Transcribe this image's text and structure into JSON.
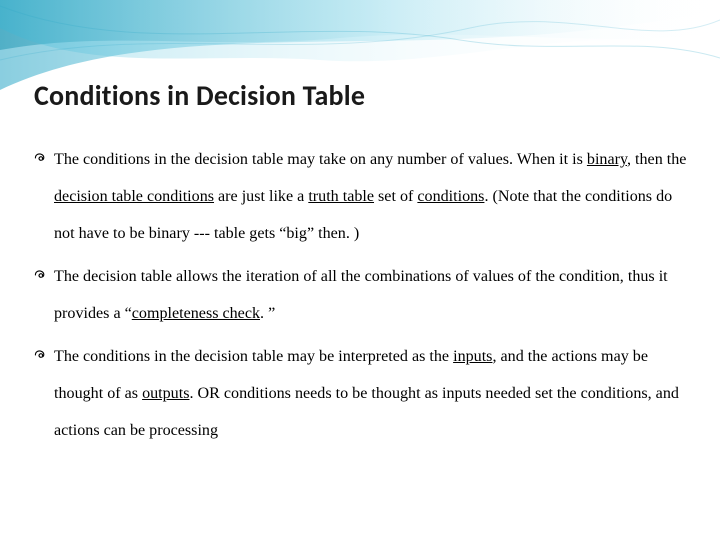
{
  "slide": {
    "title": "Conditions in Decision Table",
    "bullets": [
      {
        "pre": "The conditions in the decision table may take on any number of values. When it is ",
        "u1": "binary",
        "mid1": ", then the ",
        "u2": "decision table conditions",
        "mid2": " are just like a ",
        "u3": "truth table",
        "mid3": " set of ",
        "u4": "conditions",
        "post": ". (Note that the conditions do not have to be binary --- table gets “big” then. )"
      },
      {
        "pre": "The decision table allows the iteration of all the combinations of values of the condition, thus it provides a “",
        "u1": "completeness check",
        "post": ". ”"
      },
      {
        "pre": "The conditions in the decision table may be interpreted as the ",
        "u1": "inputs",
        "mid1": ", and the actions may be thought of as ",
        "u2": "outputs",
        "post": ". OR conditions needs to be thought as inputs needed set the conditions, and actions can be processing"
      }
    ]
  }
}
